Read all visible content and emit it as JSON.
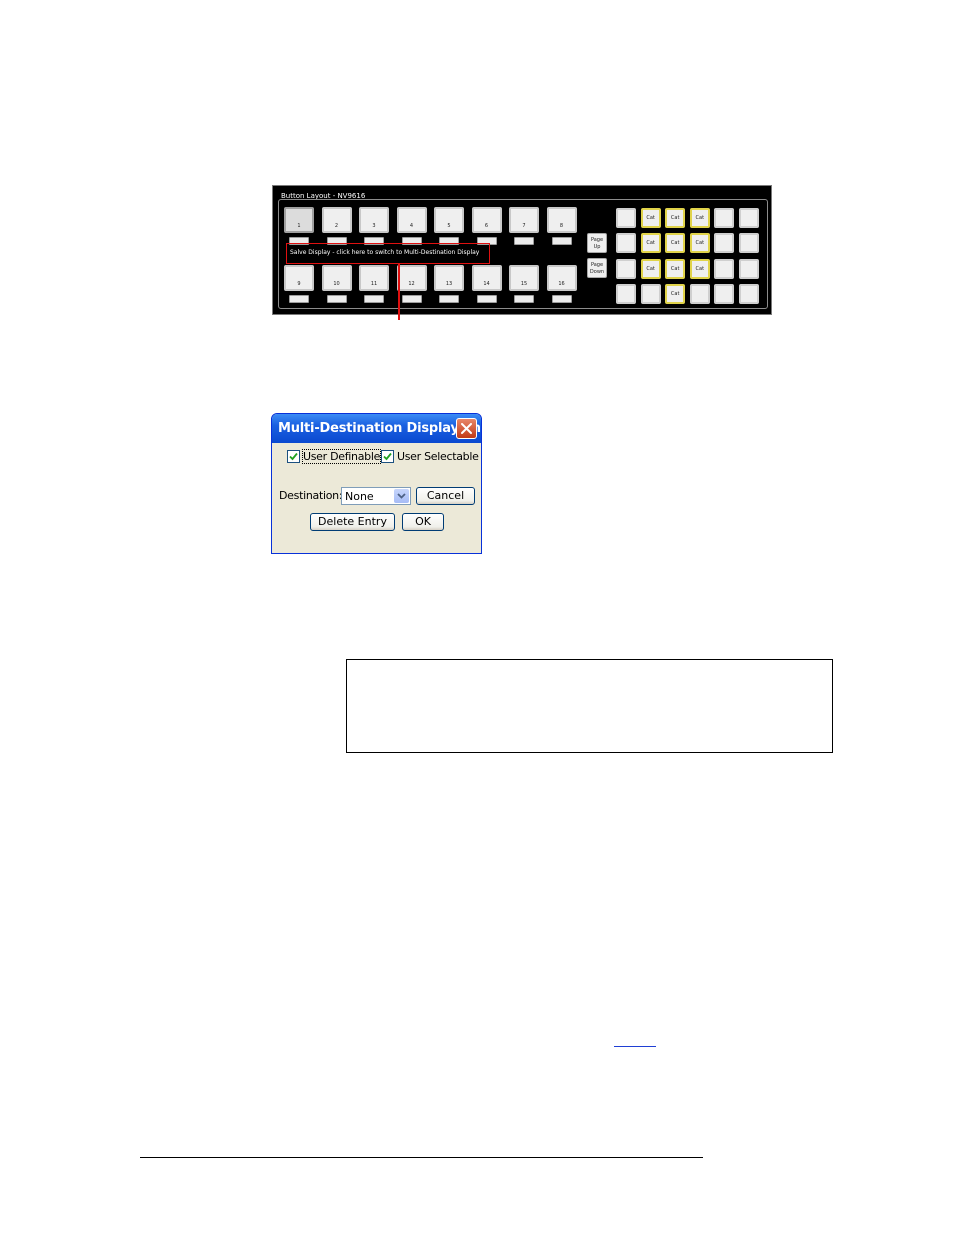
{
  "button_layout": {
    "title": "Button Layout - NV9616",
    "top_buttons": [
      "1",
      "2",
      "3",
      "4",
      "5",
      "6",
      "7",
      "8"
    ],
    "bottom_buttons": [
      "9",
      "10",
      "11",
      "12",
      "13",
      "14",
      "15",
      "16"
    ],
    "status_message": "Salve Display - click here to switch to Multi-Destination Display",
    "page_up_label": "Page Up",
    "page_down_label": "Page Down",
    "category_grid": [
      [
        "",
        "Cat",
        "Cat",
        "Cat",
        "",
        ""
      ],
      [
        "",
        "Cat",
        "Cat",
        "Cat",
        "",
        ""
      ],
      [
        "",
        "Cat",
        "Cat",
        "Cat",
        "",
        ""
      ],
      [
        "",
        "",
        "Cat",
        "",
        "",
        ""
      ]
    ],
    "colors": {
      "callout": "#e01010",
      "category_border": "#e0d34a"
    }
  },
  "dialog": {
    "title": "Multi-Destination Display En...",
    "user_definable_label": "User Definable",
    "user_definable_checked": true,
    "user_selectable_label": "User Selectable",
    "user_selectable_checked": true,
    "destination_label": "Destination:",
    "destination_value": "None",
    "cancel_label": "Cancel",
    "delete_entry_label": "Delete Entry",
    "ok_label": "OK"
  }
}
